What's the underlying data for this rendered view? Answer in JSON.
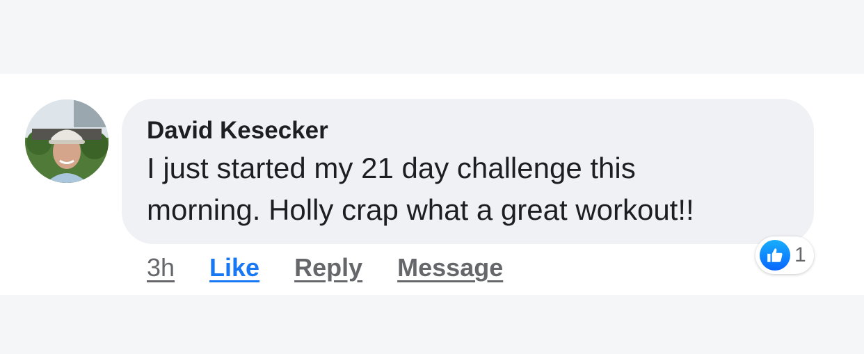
{
  "comment": {
    "author": "David Kesecker",
    "text_line1": "I just started my 21 day challenge this",
    "text_line2": "morning. Holly crap what a great workout!!",
    "time": "3h",
    "actions": {
      "like": "Like",
      "reply": "Reply",
      "message": "Message"
    },
    "reactions": {
      "icon": "like-thumb-icon",
      "count": "1"
    }
  },
  "colors": {
    "page_background": "#f5f6f8",
    "bubble_background": "#f0f1f4",
    "like_blue": "#1877f2",
    "secondary_text": "#65676b"
  }
}
